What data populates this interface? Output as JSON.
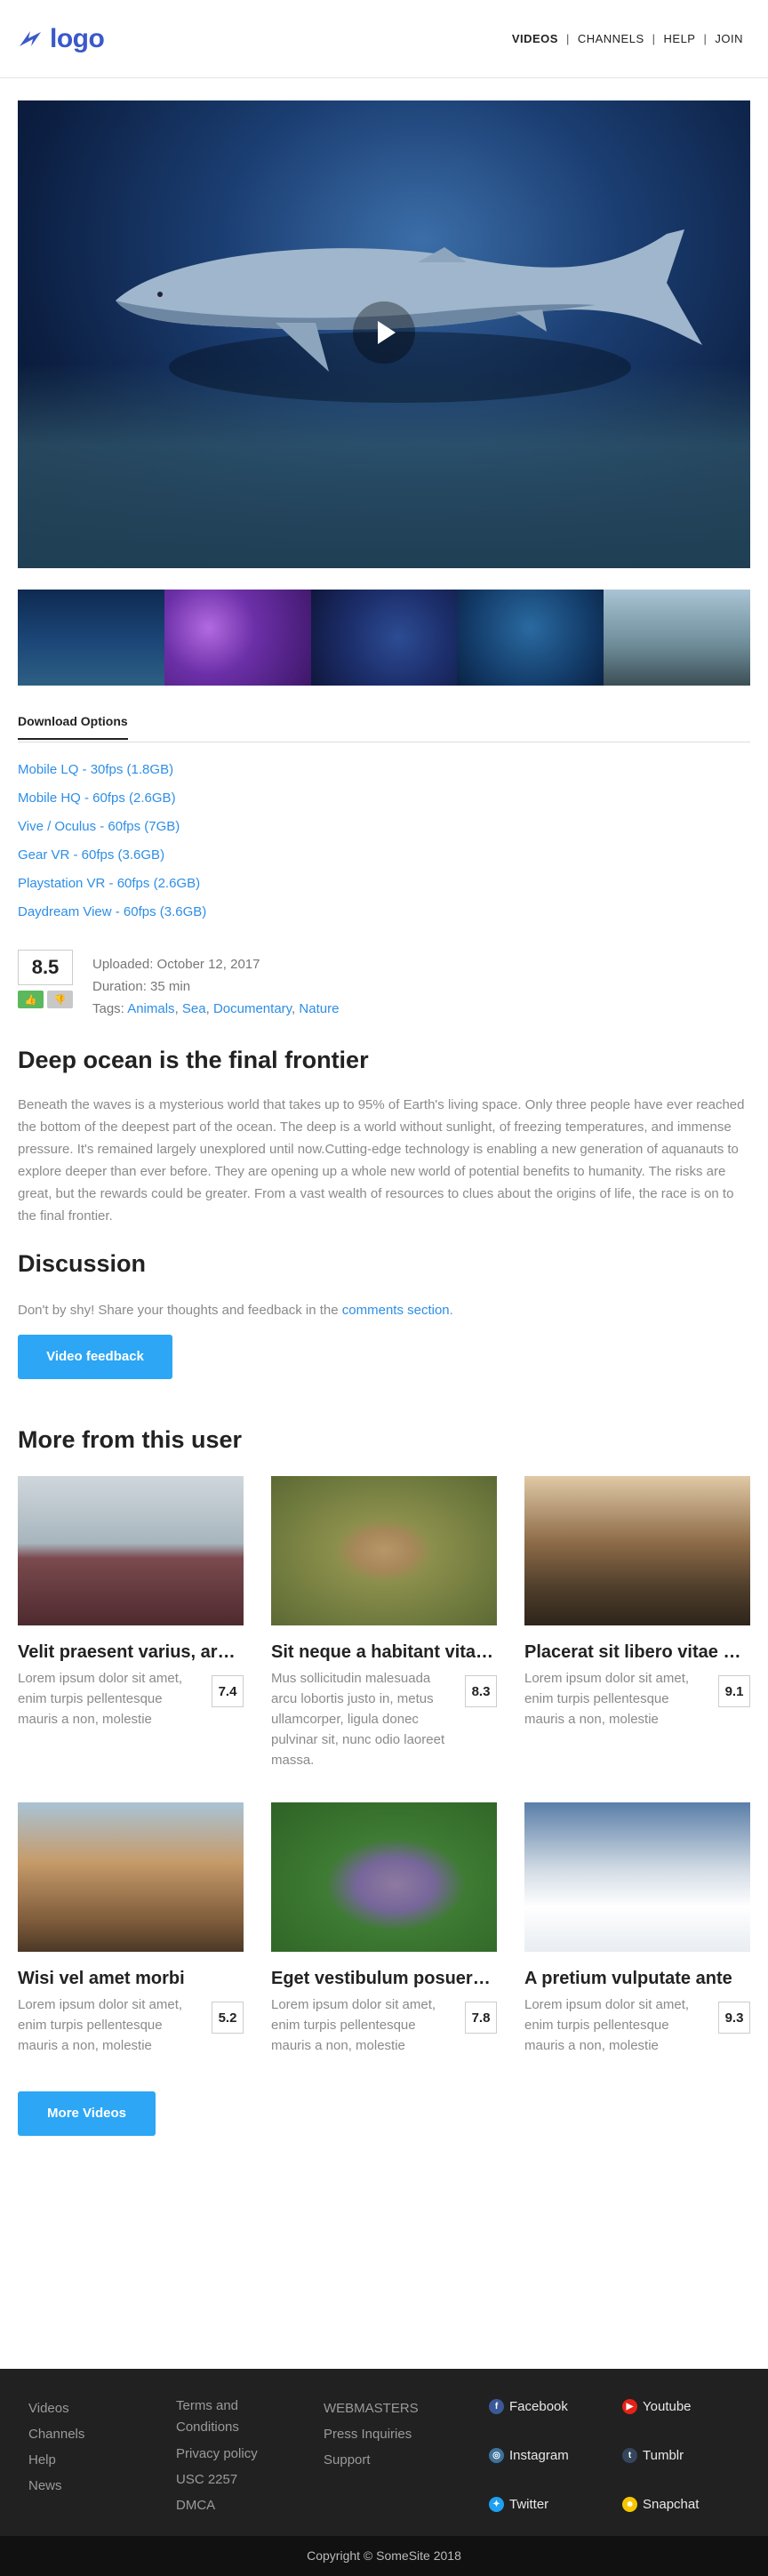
{
  "header": {
    "logo_text": "logo",
    "nav": [
      {
        "label": "VIDEOS"
      },
      {
        "label": "CHANNELS"
      },
      {
        "label": "HELP"
      },
      {
        "label": "JOIN"
      }
    ],
    "separator": "|"
  },
  "player": {
    "play_icon": "play-icon"
  },
  "thumbnails": [
    "thumbnail-1",
    "thumbnail-2",
    "thumbnail-3",
    "thumbnail-4",
    "thumbnail-5"
  ],
  "download_tab": "Download Options",
  "downloads": [
    "Mobile LQ - 30fps (1.8GB)",
    "Mobile HQ - 60fps (2.6GB)",
    "Vive / Oculus - 60fps (7GB)",
    "Gear VR - 60fps (3.6GB)",
    "Playstation VR - 60fps (2.6GB)",
    "Daydream View - 60fps (3.6GB)"
  ],
  "meta": {
    "rating": "8.5",
    "uploaded": "Uploaded: October 12, 2017",
    "duration": "Duration: 35 min",
    "tags_label": "Tags: ",
    "tags": [
      "Animals",
      "Sea",
      "Documentary",
      "Nature"
    ],
    "tag_separator": ", "
  },
  "video": {
    "title": "Deep ocean is the final frontier",
    "description": "Beneath the waves is a mysterious world that takes up to 95% of Earth's living space. Only three people have ever reached the bottom of the deepest part of the ocean. The deep is a world without sunlight, of freezing temperatures, and immense pressure. It's remained largely unexplored until now.Cutting-edge technology is enabling a new generation of aquanauts to explore deeper than ever before. They are opening up a whole new world of potential benefits to humanity. The risks are great, but the rewards could be greater. From a vast wealth of resources to clues about the origins of life, the race is on to the final frontier."
  },
  "discussion": {
    "title": "Discussion",
    "text": "Don't by shy! Share your thoughts and feedback in the ",
    "link": "comments section",
    "text_end": ".",
    "button": "Video feedback"
  },
  "more": {
    "title": "More from this user",
    "items": [
      {
        "title": "Velit praesent varius, arcu...",
        "desc": "Lorem ipsum dolor sit amet, enim turpis pellentesque mauris a non, molestie",
        "score": "7.4"
      },
      {
        "title": "Sit neque a habitant vitae,...",
        "desc": "Mus sollicitudin malesuada arcu lobortis justo in, metus ullamcorper, ligula donec pulvinar sit, nunc odio laoreet massa.",
        "score": "8.3"
      },
      {
        "title": "Placerat sit libero vitae at ...",
        "desc": "Lorem ipsum dolor sit amet, enim turpis pellentesque mauris a non, molestie",
        "score": "9.1"
      },
      {
        "title": "Wisi vel amet morbi",
        "desc": "Lorem ipsum dolor sit amet, enim turpis pellentesque mauris a non, molestie",
        "score": "5.2"
      },
      {
        "title": "Eget vestibulum posuere l...",
        "desc": "Lorem ipsum dolor sit amet, enim turpis pellentesque mauris a non, molestie",
        "score": "7.8"
      },
      {
        "title": "A pretium vulputate ante",
        "desc": "Lorem ipsum dolor sit amet, enim turpis pellentesque mauris a non, molestie",
        "score": "9.3"
      }
    ],
    "button": "More Videos"
  },
  "footer": {
    "col1": [
      "Videos",
      "Channels",
      "Help",
      "News"
    ],
    "col2": [
      "Terms and Conditions",
      "Privacy policy",
      "USC 2257",
      "DMCA"
    ],
    "col3": [
      "WEBMASTERS",
      "Press Inquiries",
      "Support"
    ],
    "social": [
      {
        "label": "Facebook",
        "icon": "facebook-icon",
        "color": "#3b5998",
        "glyph": "f"
      },
      {
        "label": "Youtube",
        "icon": "youtube-icon",
        "color": "#e62117",
        "glyph": "▶"
      },
      {
        "label": "Instagram",
        "icon": "instagram-icon",
        "color": "#3f729b",
        "glyph": "◎"
      },
      {
        "label": "Tumblr",
        "icon": "tumblr-icon",
        "color": "#35465c",
        "glyph": "t"
      },
      {
        "label": "Twitter",
        "icon": "twitter-icon",
        "color": "#1da1f2",
        "glyph": "✦"
      },
      {
        "label": "Snapchat",
        "icon": "snapchat-icon",
        "color": "#f7c600",
        "glyph": "☻"
      }
    ],
    "copyright": "Copyright © SomeSite 2018"
  },
  "colors": {
    "accent": "#2ca6f5",
    "link": "#2d8ee6",
    "footer_bg": "#212121"
  }
}
